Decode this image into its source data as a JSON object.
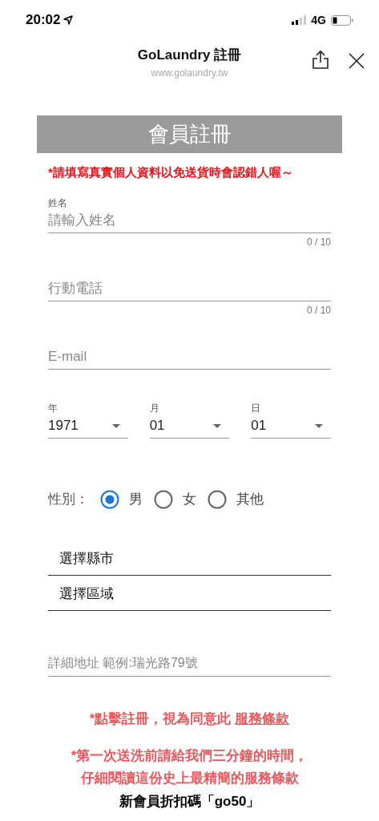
{
  "status_bar": {
    "time": "20:02",
    "network": "4G"
  },
  "browser_header": {
    "title": "GoLaundry 註冊",
    "url": "www.golaundry.tw"
  },
  "banner": {
    "title": "會員註冊"
  },
  "warning": "*請填寫真實個人資料以免送貨時會認錯人喔～",
  "fields": [
    {
      "label": "姓名",
      "placeholder": "請輸入姓名",
      "counter": "0 / 10"
    },
    {
      "placeholder": "行動電話",
      "counter": "0 / 10"
    },
    {
      "placeholder": "E-mail"
    }
  ],
  "birthday": [
    {
      "label": "年",
      "value": "1971"
    },
    {
      "label": "月",
      "value": "01"
    },
    {
      "label": "日",
      "value": "01"
    }
  ],
  "gender": {
    "label": "性別：",
    "options": [
      {
        "label": "男",
        "selected": true
      },
      {
        "label": "女",
        "selected": false
      },
      {
        "label": "其他",
        "selected": false
      }
    ]
  },
  "selects": [
    {
      "value": "選擇縣市"
    },
    {
      "value": "選擇區域"
    }
  ],
  "address": {
    "placeholder": "詳細地址 範例:瑞光路79號"
  },
  "terms": {
    "text": "*點擊註冊，視為同意此",
    "link": "服務條款"
  },
  "note": "*第一次送洗前請給我們三分鐘的時間，仔細閱讀這份史上最精簡的服務條款",
  "promo": "新會員折扣碼「go50」"
}
